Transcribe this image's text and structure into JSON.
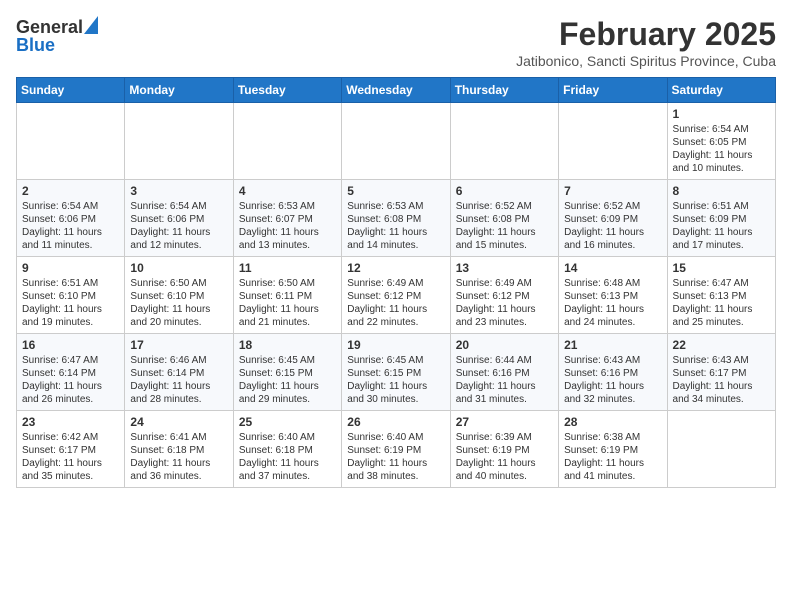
{
  "header": {
    "logo_general": "General",
    "logo_blue": "Blue",
    "month_year": "February 2025",
    "location": "Jatibonico, Sancti Spiritus Province, Cuba"
  },
  "weekdays": [
    "Sunday",
    "Monday",
    "Tuesday",
    "Wednesday",
    "Thursday",
    "Friday",
    "Saturday"
  ],
  "weeks": [
    [
      {
        "day": "",
        "info": ""
      },
      {
        "day": "",
        "info": ""
      },
      {
        "day": "",
        "info": ""
      },
      {
        "day": "",
        "info": ""
      },
      {
        "day": "",
        "info": ""
      },
      {
        "day": "",
        "info": ""
      },
      {
        "day": "1",
        "info": "Sunrise: 6:54 AM\nSunset: 6:05 PM\nDaylight: 11 hours\nand 10 minutes."
      }
    ],
    [
      {
        "day": "2",
        "info": "Sunrise: 6:54 AM\nSunset: 6:06 PM\nDaylight: 11 hours\nand 11 minutes."
      },
      {
        "day": "3",
        "info": "Sunrise: 6:54 AM\nSunset: 6:06 PM\nDaylight: 11 hours\nand 12 minutes."
      },
      {
        "day": "4",
        "info": "Sunrise: 6:53 AM\nSunset: 6:07 PM\nDaylight: 11 hours\nand 13 minutes."
      },
      {
        "day": "5",
        "info": "Sunrise: 6:53 AM\nSunset: 6:08 PM\nDaylight: 11 hours\nand 14 minutes."
      },
      {
        "day": "6",
        "info": "Sunrise: 6:52 AM\nSunset: 6:08 PM\nDaylight: 11 hours\nand 15 minutes."
      },
      {
        "day": "7",
        "info": "Sunrise: 6:52 AM\nSunset: 6:09 PM\nDaylight: 11 hours\nand 16 minutes."
      },
      {
        "day": "8",
        "info": "Sunrise: 6:51 AM\nSunset: 6:09 PM\nDaylight: 11 hours\nand 17 minutes."
      }
    ],
    [
      {
        "day": "9",
        "info": "Sunrise: 6:51 AM\nSunset: 6:10 PM\nDaylight: 11 hours\nand 19 minutes."
      },
      {
        "day": "10",
        "info": "Sunrise: 6:50 AM\nSunset: 6:10 PM\nDaylight: 11 hours\nand 20 minutes."
      },
      {
        "day": "11",
        "info": "Sunrise: 6:50 AM\nSunset: 6:11 PM\nDaylight: 11 hours\nand 21 minutes."
      },
      {
        "day": "12",
        "info": "Sunrise: 6:49 AM\nSunset: 6:12 PM\nDaylight: 11 hours\nand 22 minutes."
      },
      {
        "day": "13",
        "info": "Sunrise: 6:49 AM\nSunset: 6:12 PM\nDaylight: 11 hours\nand 23 minutes."
      },
      {
        "day": "14",
        "info": "Sunrise: 6:48 AM\nSunset: 6:13 PM\nDaylight: 11 hours\nand 24 minutes."
      },
      {
        "day": "15",
        "info": "Sunrise: 6:47 AM\nSunset: 6:13 PM\nDaylight: 11 hours\nand 25 minutes."
      }
    ],
    [
      {
        "day": "16",
        "info": "Sunrise: 6:47 AM\nSunset: 6:14 PM\nDaylight: 11 hours\nand 26 minutes."
      },
      {
        "day": "17",
        "info": "Sunrise: 6:46 AM\nSunset: 6:14 PM\nDaylight: 11 hours\nand 28 minutes."
      },
      {
        "day": "18",
        "info": "Sunrise: 6:45 AM\nSunset: 6:15 PM\nDaylight: 11 hours\nand 29 minutes."
      },
      {
        "day": "19",
        "info": "Sunrise: 6:45 AM\nSunset: 6:15 PM\nDaylight: 11 hours\nand 30 minutes."
      },
      {
        "day": "20",
        "info": "Sunrise: 6:44 AM\nSunset: 6:16 PM\nDaylight: 11 hours\nand 31 minutes."
      },
      {
        "day": "21",
        "info": "Sunrise: 6:43 AM\nSunset: 6:16 PM\nDaylight: 11 hours\nand 32 minutes."
      },
      {
        "day": "22",
        "info": "Sunrise: 6:43 AM\nSunset: 6:17 PM\nDaylight: 11 hours\nand 34 minutes."
      }
    ],
    [
      {
        "day": "23",
        "info": "Sunrise: 6:42 AM\nSunset: 6:17 PM\nDaylight: 11 hours\nand 35 minutes."
      },
      {
        "day": "24",
        "info": "Sunrise: 6:41 AM\nSunset: 6:18 PM\nDaylight: 11 hours\nand 36 minutes."
      },
      {
        "day": "25",
        "info": "Sunrise: 6:40 AM\nSunset: 6:18 PM\nDaylight: 11 hours\nand 37 minutes."
      },
      {
        "day": "26",
        "info": "Sunrise: 6:40 AM\nSunset: 6:19 PM\nDaylight: 11 hours\nand 38 minutes."
      },
      {
        "day": "27",
        "info": "Sunrise: 6:39 AM\nSunset: 6:19 PM\nDaylight: 11 hours\nand 40 minutes."
      },
      {
        "day": "28",
        "info": "Sunrise: 6:38 AM\nSunset: 6:19 PM\nDaylight: 11 hours\nand 41 minutes."
      },
      {
        "day": "",
        "info": ""
      }
    ]
  ]
}
